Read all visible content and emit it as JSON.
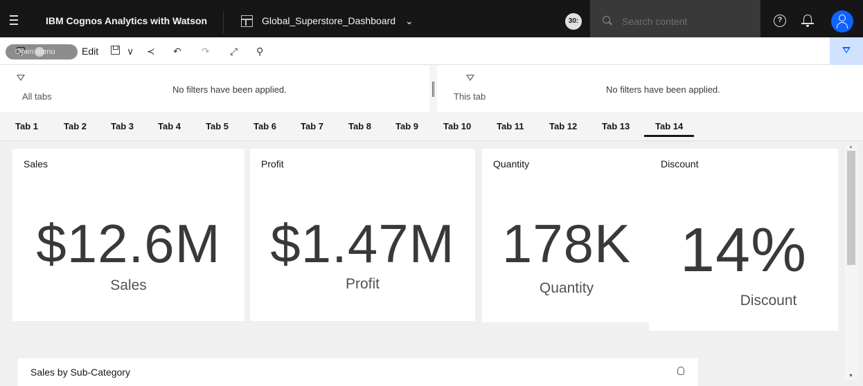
{
  "header": {
    "app_title": "IBM Cognos Analytics with Watson",
    "dashboard_name": "Global_Superstore_Dashboard",
    "badge": "30:",
    "search_placeholder": "Search content",
    "help_glyph": "?"
  },
  "toolbar": {
    "open_menu_label": "Open menu",
    "edit_label": "Edit",
    "save_dropdown_glyph": "∨",
    "share_glyph": "≺",
    "undo_glyph": "↶",
    "redo_glyph": "↷",
    "fullscreen_glyph": "⤢",
    "pin_glyph": "⚲"
  },
  "filters": {
    "all_tabs": {
      "label": "All tabs",
      "message": "No filters have been applied."
    },
    "this_tab": {
      "label": "This tab",
      "message": "No filters have been applied."
    }
  },
  "tabs": [
    "Tab 1",
    "Tab 2",
    "Tab 3",
    "Tab 4",
    "Tab 5",
    "Tab 6",
    "Tab 7",
    "Tab 8",
    "Tab 9",
    "Tab 10",
    "Tab 11",
    "Tab 12",
    "Tab 13",
    "Tab 14"
  ],
  "active_tab": "Tab 14",
  "kpis": {
    "sales": {
      "title": "Sales",
      "value": "$12.6M",
      "label": "Sales"
    },
    "profit": {
      "title": "Profit",
      "value": "$1.47M",
      "label": "Profit"
    },
    "quantity": {
      "title": "Quantity",
      "value": "178K",
      "label": "Quantity"
    },
    "discount": {
      "title": "Discount",
      "value": "14%",
      "label": "Discount"
    }
  },
  "bottom_card": {
    "title": "Sales by Sub-Category"
  },
  "colors": {
    "topbar": "#161616",
    "accent": "#0f62fe",
    "search_bg": "#393939"
  }
}
